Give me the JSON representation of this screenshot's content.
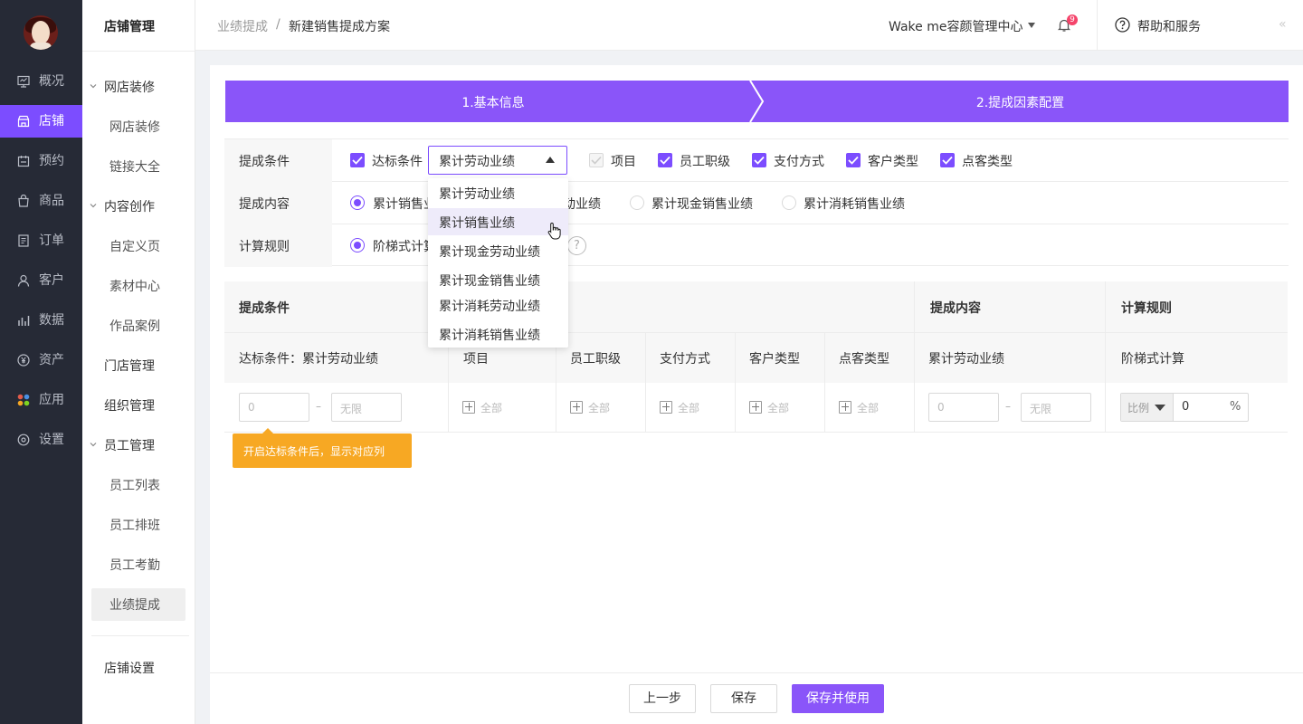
{
  "nav": {
    "items": [
      {
        "label": "概况",
        "icon": "monitor-icon"
      },
      {
        "label": "店铺",
        "icon": "store-icon"
      },
      {
        "label": "预约",
        "icon": "calendar-icon"
      },
      {
        "label": "商品",
        "icon": "bag-icon"
      },
      {
        "label": "订单",
        "icon": "list-icon"
      },
      {
        "label": "客户",
        "icon": "user-icon"
      },
      {
        "label": "数据",
        "icon": "bar-chart-icon"
      },
      {
        "label": "资产",
        "icon": "yen-icon"
      },
      {
        "label": "应用",
        "icon": "apps-icon"
      },
      {
        "label": "设置",
        "icon": "gear-icon"
      }
    ],
    "active": "店铺",
    "accent": "#7c4dff"
  },
  "sub": {
    "title": "店铺管理",
    "groups": {
      "decor": "网店装修",
      "decor_items": [
        "网店装修",
        "链接大全"
      ],
      "content": "内容创作",
      "content_items": [
        "自定义页",
        "素材中心",
        "作品案例"
      ],
      "store": "门店管理",
      "org": "组织管理",
      "staff": "员工管理",
      "staff_items": [
        "员工列表",
        "员工排班",
        "员工考勤",
        "业绩提成"
      ],
      "settings": "店铺设置"
    }
  },
  "header": {
    "breadcrumb_parent": "业绩提成",
    "breadcrumb_sep": "/",
    "breadcrumb_current": "新建销售提成方案",
    "shop_name": "Wake me容颜管理中心",
    "notif_count": "9",
    "help": "帮助和服务",
    "collapse": "«"
  },
  "steps": {
    "step1": "1.基本信息",
    "step2": "2.提成因素配置"
  },
  "form": {
    "cond_label": "提成条件",
    "cond_checkbox": "达标条件",
    "cond_select_value": "累计劳动业绩",
    "cond_options": [
      "项目",
      "员工职级",
      "支付方式",
      "客户类型",
      "点客类型"
    ],
    "content_label": "提成内容",
    "content_radios": [
      "累计销售业绩",
      "动业绩",
      "累计现金销售业绩",
      "累计消耗销售业绩"
    ],
    "rule_label": "计算规则",
    "rule_radio": "阶梯式计算",
    "help_mark": "?"
  },
  "dropdown": {
    "options": [
      "累计劳动业绩",
      "累计销售业绩",
      "累计现金劳动业绩",
      "累计现金销售业绩",
      "累计消耗劳动业绩",
      "累计消耗销售业绩"
    ],
    "hovered": "累计销售业绩"
  },
  "table": {
    "group_headers": [
      "提成条件",
      "提成内容",
      "计算规则"
    ],
    "columns": [
      "达标条件：累计劳动业绩",
      "项目",
      "员工职级",
      "支付方式",
      "客户类型",
      "点客类型",
      "累计劳动业绩",
      "阶梯式计算"
    ],
    "row": {
      "min_placeholder": "0",
      "range_dash": "–",
      "max_placeholder": "无限",
      "all_label": "全部",
      "ratio_select": "比例",
      "ratio_value": "0",
      "ratio_unit": "%"
    },
    "tip": "开启达标条件后，显示对应列",
    "tip_color": "#f7a823"
  },
  "footer": {
    "prev": "上一步",
    "save": "保存",
    "save_use": "保存并使用"
  }
}
